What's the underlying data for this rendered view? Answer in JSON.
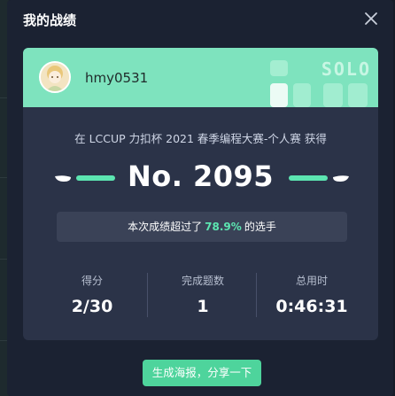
{
  "dialog": {
    "title": "我的战绩",
    "close_icon": "close-icon"
  },
  "header": {
    "username": "hmy0531",
    "mode_badge": "SOLO",
    "colors": {
      "header_bg": "#7ee3be",
      "accent": "#5ce5b1"
    }
  },
  "result": {
    "achievement": "在 LCCUP 力扣杯 2021 春季编程大赛-个人赛 获得",
    "rank": "No. 2095",
    "exceed_prefix": "本次成绩超过了",
    "exceed_percent": "78.9%",
    "exceed_suffix": "的选手"
  },
  "stats": [
    {
      "label": "得分",
      "value": "2/30"
    },
    {
      "label": "完成题数",
      "value": "1"
    },
    {
      "label": "总用时",
      "value": "0:46:31"
    }
  ],
  "share_button": "生成海报，分享一下"
}
